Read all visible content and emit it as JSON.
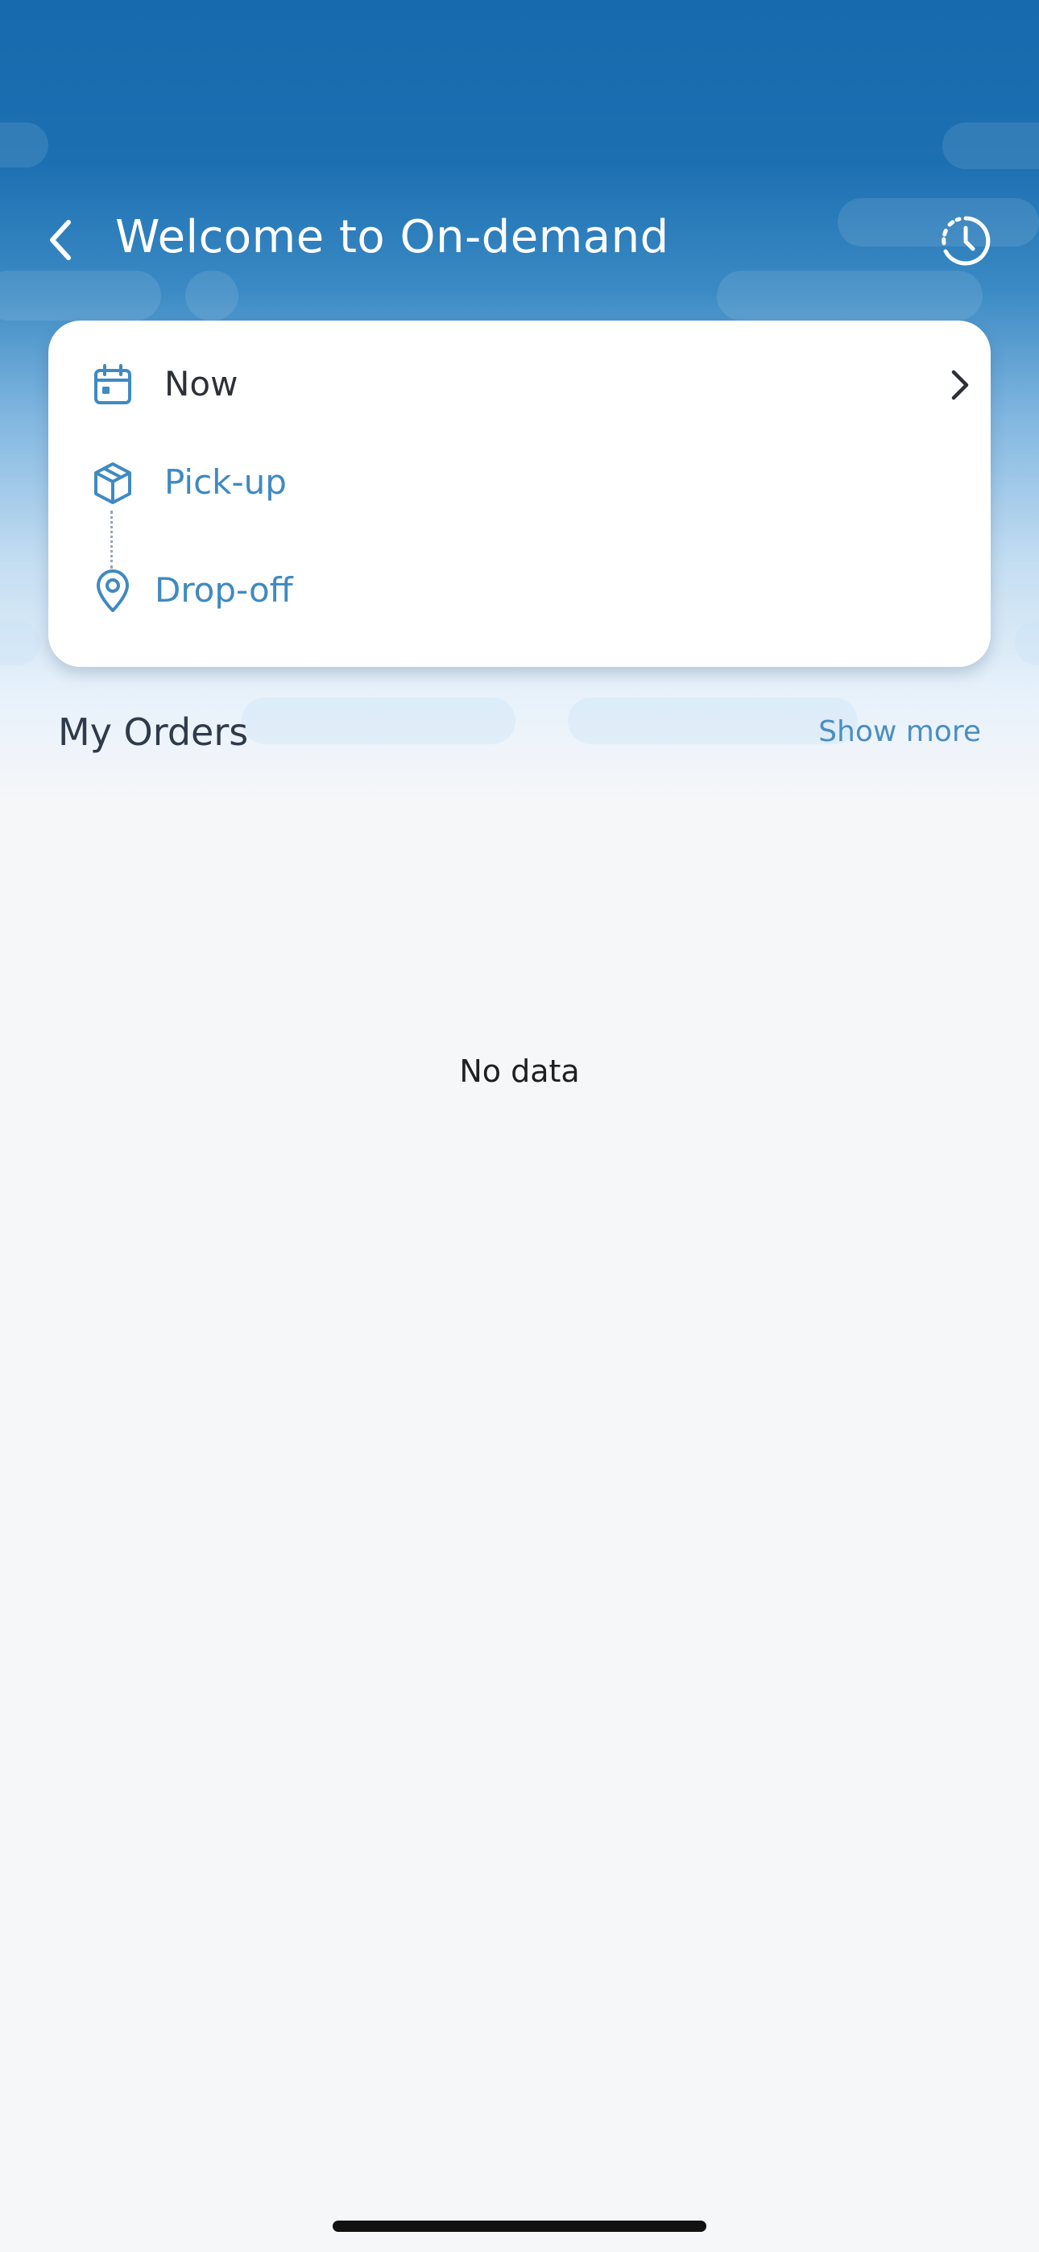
{
  "header": {
    "title": "Welcome to On-demand",
    "back_icon": "chevron-left-icon",
    "history_icon": "history-clock-icon"
  },
  "booking_card": {
    "schedule": {
      "label": "Now",
      "icon": "calendar-icon",
      "trailing_icon": "chevron-right-icon"
    },
    "pickup": {
      "label": "Pick-up",
      "icon": "package-box-icon"
    },
    "dropoff": {
      "label": "Drop-off",
      "icon": "location-pin-icon"
    }
  },
  "orders": {
    "title": "My Orders",
    "show_more_label": "Show more",
    "empty_text": "No data"
  },
  "colors": {
    "brand_blue": "#176aad",
    "accent_blue": "#3f8ac1",
    "background": "#f6f7f9",
    "text_dark": "#2d3136"
  }
}
